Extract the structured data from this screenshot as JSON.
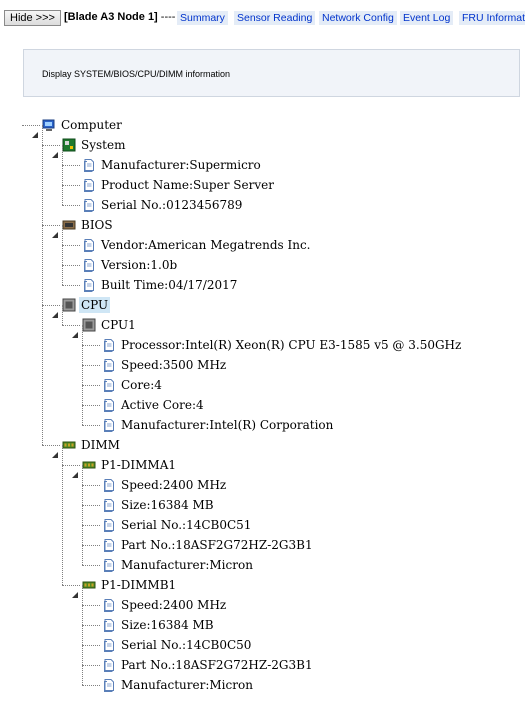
{
  "toolbar": {
    "hide_label": "Hide >>>",
    "node_title": "[Blade A3 Node 1]",
    "separator": "----",
    "links": [
      "Summary",
      "Sensor Reading",
      "Network Config",
      "Event Log",
      "FRU Informatio"
    ]
  },
  "info": {
    "text": "Display SYSTEM/BIOS/CPU/DIMM information"
  },
  "tree": {
    "root": "Computer",
    "system": {
      "label": "System",
      "items": [
        "Manufacturer:Supermicro",
        "Product Name:Super Server",
        "Serial No.:0123456789"
      ]
    },
    "bios": {
      "label": "BIOS",
      "items": [
        "Vendor:American Megatrends Inc.",
        "Version:1.0b",
        "Built Time:04/17/2017"
      ]
    },
    "cpu": {
      "label": "CPU",
      "cpu1": {
        "label": "CPU1",
        "items": [
          "Processor:Intel(R) Xeon(R) CPU E3-1585 v5 @ 3.50GHz",
          "Speed:3500 MHz",
          "Core:4",
          "Active Core:4",
          "Manufacturer:Intel(R) Corporation"
        ]
      }
    },
    "dimm": {
      "label": "DIMM",
      "dimma1": {
        "label": "P1-DIMMA1",
        "items": [
          "Speed:2400 MHz",
          "Size:16384 MB",
          "Serial No.:14CB0C51",
          "Part No.:18ASF2G72HZ-2G3B1",
          "Manufacturer:Micron"
        ]
      },
      "dimmb1": {
        "label": "P1-DIMMB1",
        "items": [
          "Speed:2400 MHz",
          "Size:16384 MB",
          "Serial No.:14CB0C50",
          "Part No.:18ASF2G72HZ-2G3B1",
          "Manufacturer:Micron"
        ]
      }
    }
  },
  "colors": {
    "link": "#0033cc",
    "link_bg": "#e4ecf7",
    "selected_bg": "#cfe6f5",
    "info_bg": "#f1f4f9"
  },
  "icons": {
    "root": "computer-icon",
    "system": "motherboard-icon",
    "bios": "chip-icon",
    "cpu": "processor-icon",
    "dimm": "memory-icon",
    "leaf": "document-icon"
  }
}
